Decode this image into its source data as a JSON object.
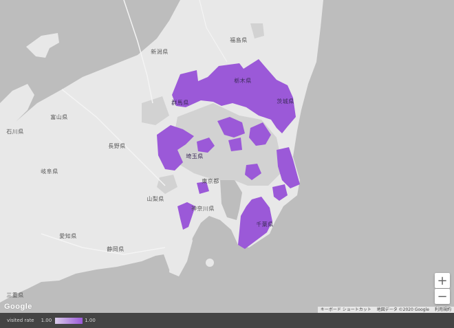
{
  "map": {
    "labels": [
      {
        "id": "fukushima",
        "text": "福島県"
      },
      {
        "id": "niigata",
        "text": "新潟県"
      },
      {
        "id": "tochigi",
        "text": "栃木県"
      },
      {
        "id": "gunma",
        "text": "群馬県"
      },
      {
        "id": "ibaraki",
        "text": "茨城県"
      },
      {
        "id": "toyama",
        "text": "富山県"
      },
      {
        "id": "ishikawa",
        "text": "石川県"
      },
      {
        "id": "nagano",
        "text": "長野県"
      },
      {
        "id": "gifu",
        "text": "岐阜県"
      },
      {
        "id": "saitama",
        "text": "埼玉県"
      },
      {
        "id": "tokyo",
        "text": "東京都"
      },
      {
        "id": "yamanashi",
        "text": "山梨県"
      },
      {
        "id": "kanagawa",
        "text": "神奈川県"
      },
      {
        "id": "chiba",
        "text": "千葉県"
      },
      {
        "id": "aichi",
        "text": "愛知県"
      },
      {
        "id": "shizuoka",
        "text": "静岡県"
      },
      {
        "id": "mie",
        "text": "三重県"
      }
    ],
    "colors": {
      "sea": "#bdbdbd",
      "land": "#e8e8e8",
      "unvisited": "#d2d2d2",
      "visited": "#9b59d8"
    }
  },
  "controls": {
    "zoom_in": "+",
    "zoom_out": "−"
  },
  "google_logo": "Google",
  "attribution": {
    "shortcuts": "キーボード ショートカット",
    "map_data": "地図データ ©2020 Google",
    "terms": "利用規約"
  },
  "legend": {
    "title": "visited rate",
    "min": "1.00",
    "max": "1.00",
    "gradient_start": "#d9cce9",
    "gradient_end": "#9b59d8"
  }
}
